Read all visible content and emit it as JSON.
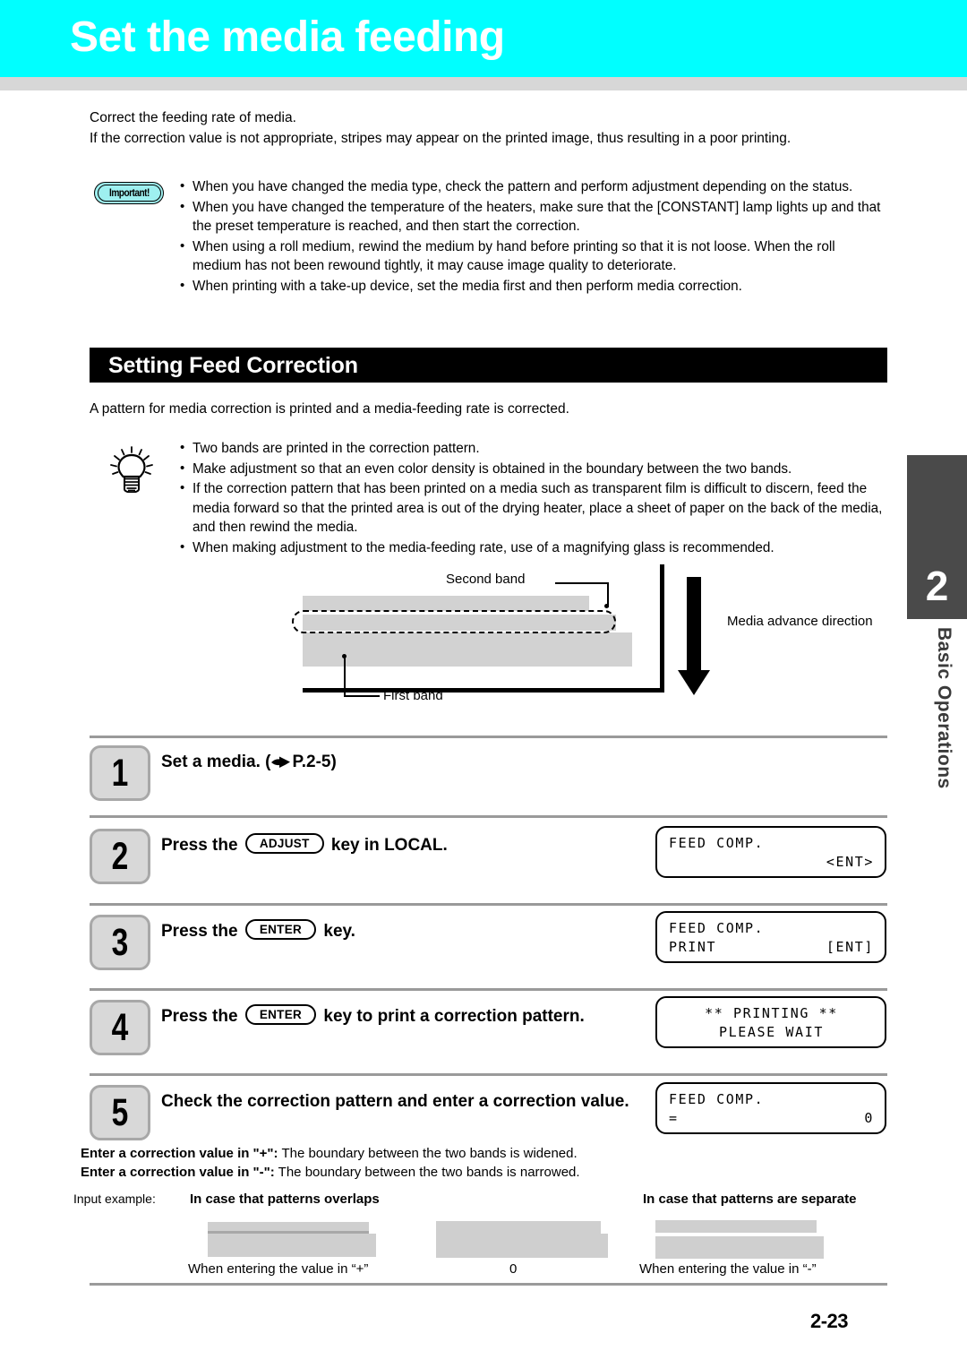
{
  "header": {
    "title": "Set the media feeding",
    "bar_color": "#00ffff"
  },
  "intro": {
    "line1": "Correct the feeding rate of media.",
    "line2": "If the correction value is not appropriate, stripes may appear on the printed image, thus resulting in a poor printing."
  },
  "important": {
    "icon_label": "Important!",
    "bullets": [
      "When you have changed the media type, check the pattern and perform adjustment depending on the status.",
      "When you have changed the temperature of the heaters, make sure that the [CONSTANT] lamp lights up and that the preset temperature is reached, and then start the correction.",
      "When using a roll medium, rewind the medium by hand before printing so that it is not loose. When the roll medium has not been rewound tightly, it may cause image quality to deteriorate.",
      "When printing with a take-up device, set the media first and then perform media correction."
    ]
  },
  "section": {
    "heading": "Setting Feed Correction",
    "intro": "A pattern for media correction is printed and a media-feeding rate is corrected.",
    "hints": [
      "Two bands are printed in the correction pattern.",
      "Make adjustment so that an even color density is obtained in the boundary between the two bands.",
      "If the correction pattern that has been printed on a media such as transparent film is difficult to discern, feed the media forward so that the printed area is out of the drying heater, place a sheet of paper on the back of the media, and then rewind the media.",
      "When making adjustment to the media-feeding rate, use of a magnifying glass is recommended."
    ]
  },
  "diagram": {
    "label_second_band": "Second band",
    "label_first_band": "First band",
    "label_media_advance": "Media advance direction"
  },
  "steps": [
    {
      "number": "1",
      "text_before": "Set a media. (",
      "text_link": "P.2-5",
      "text_after": ")",
      "lcd": null
    },
    {
      "number": "2",
      "text_before": "Press the ",
      "key": "ADJUST",
      "text_after": " key in LOCAL.",
      "lcd": {
        "line1_left": "FEED COMP.",
        "line1_right": "",
        "line2_left": "",
        "line2_right": "<ENT>"
      }
    },
    {
      "number": "3",
      "text_before": "Press the ",
      "key": "ENTER",
      "text_after": " key.",
      "lcd": {
        "line1_left": "FEED COMP.",
        "line1_right": "",
        "line2_left": "PRINT",
        "line2_right": "[ENT]"
      }
    },
    {
      "number": "4",
      "text_before": "Press the ",
      "key": "ENTER",
      "text_after": " key to print a correction pattern.",
      "lcd": {
        "line1_center": "** PRINTING **",
        "line2_center": "PLEASE WAIT"
      }
    },
    {
      "number": "5",
      "text_before": "Check the correction pattern and enter a correction value.",
      "key": "",
      "text_after": "",
      "lcd": {
        "line1_left": "FEED COMP.",
        "line1_right": "",
        "line2_left": "=",
        "line2_right": "0"
      },
      "sub_lines": [
        {
          "bold": "Enter a correction value in \"+\":",
          "rest": " The boundary between the two bands is widened."
        },
        {
          "bold": "Enter a correction value in \"-\":",
          "rest": " The boundary between the two bands is narrowed."
        }
      ]
    }
  ],
  "example": {
    "label": "Input example:",
    "head_left": "In case that patterns overlaps",
    "head_right": "In case that patterns are separate",
    "caption_left": "When entering the value in “+”",
    "caption_center": "0",
    "caption_right": "When entering the value in “-”"
  },
  "side_tab": {
    "chapter": "2",
    "label": "Basic Operations",
    "color": "#4a4a4a"
  },
  "footer": {
    "page_number": "2-23"
  }
}
